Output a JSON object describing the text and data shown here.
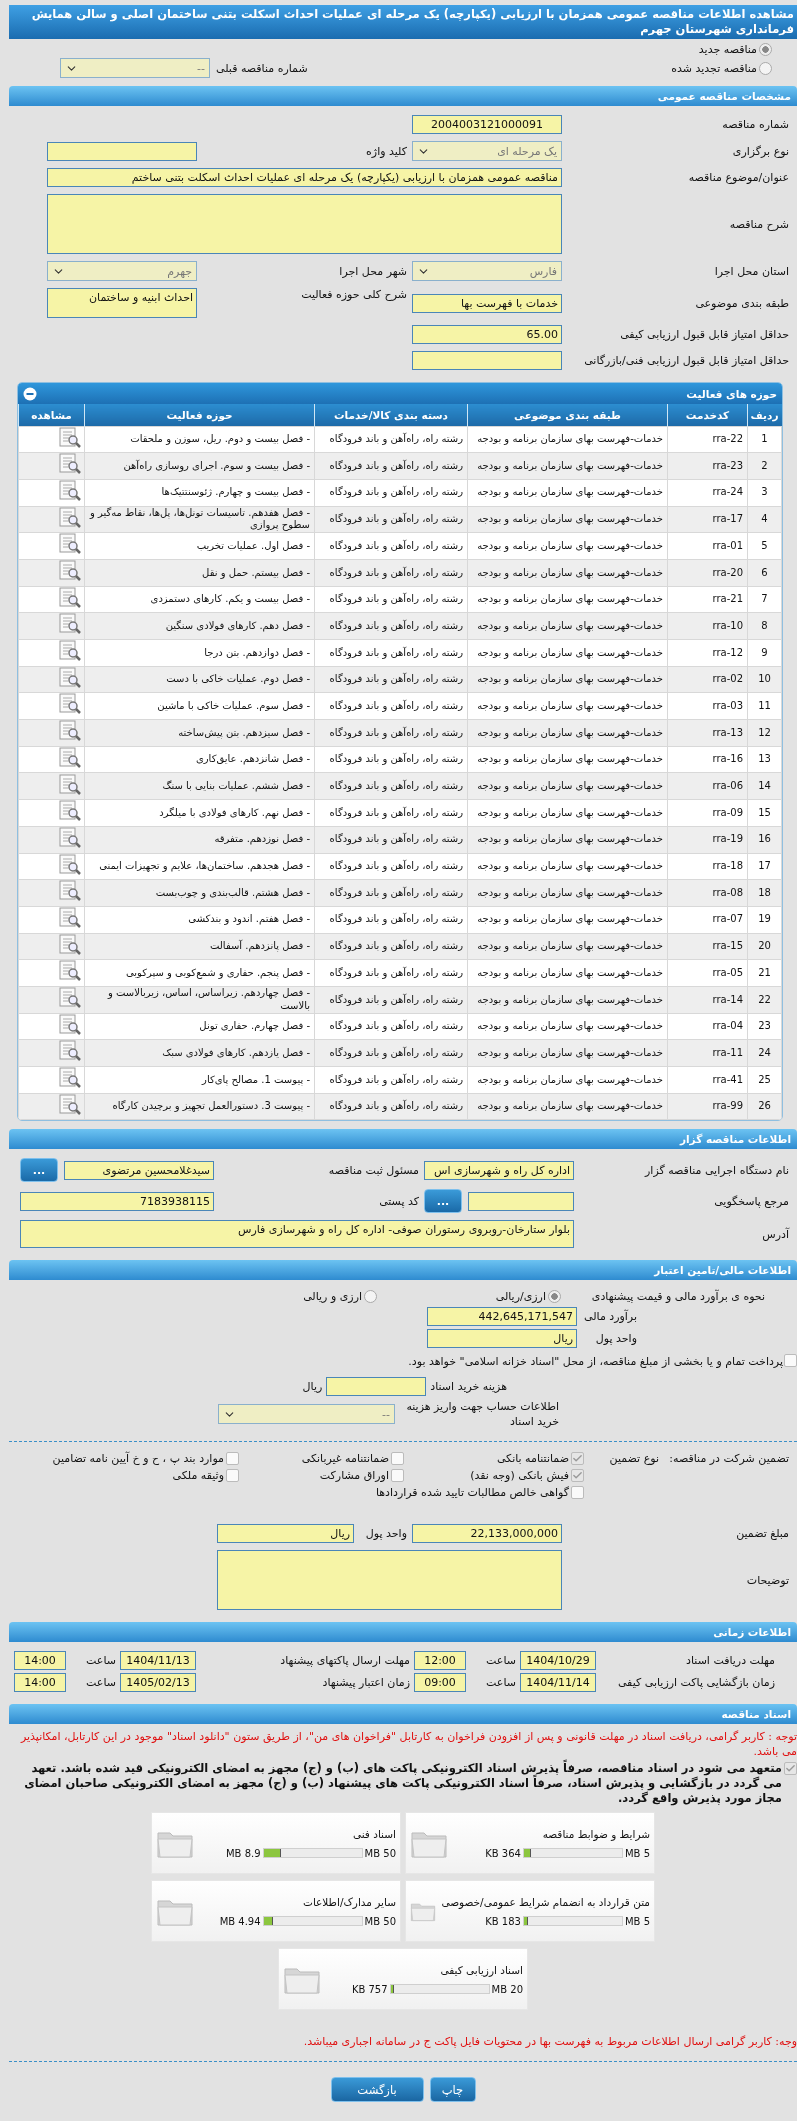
{
  "title": "مشاهده اطلاعات مناقصه عمومی همزمان با ارزیابی (یکپارچه) یک مرحله ای عملیات احداث اسکلت بتنی ساختمان اصلی و سالن همایش فرمانداری شهرستان جهرم",
  "tender_mode": {
    "options": [
      {
        "label": "مناقصه جدید",
        "selected": true
      },
      {
        "label": "مناقصه تجدید شده",
        "selected": false
      }
    ],
    "previous": {
      "label": "شماره مناقصه قبلی",
      "value": "--"
    }
  },
  "general": {
    "header": "مشخصات مناقصه عمومی",
    "rows": [
      [
        {
          "label": "شماره مناقصه",
          "value": "2004003121000091",
          "kind": "code"
        }
      ],
      [
        {
          "label": "نوع برگزاری",
          "value": "یک مرحله ای",
          "kind": "select"
        },
        {
          "label": "کلید واژه",
          "kind": "input"
        }
      ],
      [
        {
          "label": "عنوان/موضوع مناقصه",
          "value": "مناقصه عمومی همزمان با ارزیابی (یکپارچه) یک مرحله ای عملیات احداث اسکلت بتنی ساختم",
          "kind": "wide_input"
        }
      ],
      [
        {
          "label": "شرح مناقصه",
          "kind": "wide_area"
        }
      ],
      [
        {
          "label": "استان محل اجرا",
          "value": "فارس",
          "kind": "select"
        },
        {
          "label": "شهر محل اجرا",
          "value": "جهرم",
          "kind": "select"
        }
      ],
      [
        {
          "label": "طبقه بندی موضوعی",
          "value": "خدمات با فهرست بها",
          "kind": "input"
        },
        {
          "label": "شرح کلی حوزه فعالیت",
          "value": "احداث ابنیه و ساختمان",
          "kind": "memo"
        }
      ],
      [
        {
          "label": "حداقل امتیاز قابل قبول ارزیابی کیفی",
          "value": "65.00",
          "kind": "input"
        }
      ],
      [
        {
          "label": "حداقل امتیاز قابل قبول ارزیابی فنی/بازرگانی",
          "kind": "input"
        }
      ]
    ]
  },
  "activities": {
    "header": "حوزه های فعالیت",
    "columns": [
      "ردیف",
      "کدخدمت",
      "طبقه بندی موضوعی",
      "دسته بندی کالا/خدمات",
      "حوزه فعالیت",
      "مشاهده"
    ],
    "rows": [
      {
        "index": "1",
        "code": "rra-22",
        "category": "خدمات-فهرست بهای سازمان برنامه و بودجه",
        "group": "رشته راه، راه‌آهن و باند فرودگاه",
        "activity": "- فصل بیست و دوم. ریل، سوزن و ملحقات"
      },
      {
        "index": "2",
        "code": "rra-23",
        "category": "خدمات-فهرست بهای سازمان برنامه و بودجه",
        "group": "رشته راه، راه‌آهن و باند فرودگاه",
        "activity": "- فصل بیست و سوم. اجرای روسازی راه‌آهن"
      },
      {
        "index": "3",
        "code": "rra-24",
        "category": "خدمات-فهرست بهای سازمان برنامه و بودجه",
        "group": "رشته راه، راه‌آهن و باند فرودگاه",
        "activity": "- فصل بیست و چهارم. ژئوسنتتیک‌ها"
      },
      {
        "index": "4",
        "code": "rra-17",
        "category": "خدمات-فهرست بهای سازمان برنامه و بودجه",
        "group": "رشته راه، راه‌آهن و باند فرودگاه",
        "activity": "- فصل هفدهم. تاسیسات تونل‌ها، پل‌ها، نقاط مه‌گیر و سطوح پروازی"
      },
      {
        "index": "5",
        "code": "rra-01",
        "category": "خدمات-فهرست بهای سازمان برنامه و بودجه",
        "group": "رشته راه، راه‌آهن و باند فرودگاه",
        "activity": "- فصل اول. عملیات تخریب"
      },
      {
        "index": "6",
        "code": "rra-20",
        "category": "خدمات-فهرست بهای سازمان برنامه و بودجه",
        "group": "رشته راه، راه‌آهن و باند فرودگاه",
        "activity": "- فصل بیستم. حمل و نقل"
      },
      {
        "index": "7",
        "code": "rra-21",
        "category": "خدمات-فهرست بهای سازمان برنامه و بودجه",
        "group": "رشته راه، راه‌آهن و باند فرودگاه",
        "activity": "- فصل بیست و یکم. کارهای دستمزدی"
      },
      {
        "index": "8",
        "code": "rra-10",
        "category": "خدمات-فهرست بهای سازمان برنامه و بودجه",
        "group": "رشته راه، راه‌آهن و باند فرودگاه",
        "activity": "- فصل دهم. کارهای فولادی سنگین"
      },
      {
        "index": "9",
        "code": "rra-12",
        "category": "خدمات-فهرست بهای سازمان برنامه و بودجه",
        "group": "رشته راه، راه‌آهن و باند فرودگاه",
        "activity": "- فصل دوازدهم. بتن درجا"
      },
      {
        "index": "10",
        "code": "rra-02",
        "category": "خدمات-فهرست بهای سازمان برنامه و بودجه",
        "group": "رشته راه، راه‌آهن و باند فرودگاه",
        "activity": "- فصل دوم. عملیات خاکی با دست"
      },
      {
        "index": "11",
        "code": "rra-03",
        "category": "خدمات-فهرست بهای سازمان برنامه و بودجه",
        "group": "رشته راه، راه‌آهن و باند فرودگاه",
        "activity": "- فصل سوم. عملیات خاکی با ماشین"
      },
      {
        "index": "12",
        "code": "rra-13",
        "category": "خدمات-فهرست بهای سازمان برنامه و بودجه",
        "group": "رشته راه، راه‌آهن و باند فرودگاه",
        "activity": "- فصل سیزدهم. بتن پیش‌ساخته"
      },
      {
        "index": "13",
        "code": "rra-16",
        "category": "خدمات-فهرست بهای سازمان برنامه و بودجه",
        "group": "رشته راه، راه‌آهن و باند فرودگاه",
        "activity": "- فصل شانزدهم. عایق‌کاری"
      },
      {
        "index": "14",
        "code": "rra-06",
        "category": "خدمات-فهرست بهای سازمان برنامه و بودجه",
        "group": "رشته راه، راه‌آهن و باند فرودگاه",
        "activity": "- فصل ششم. عملیات بنایی با سنگ"
      },
      {
        "index": "15",
        "code": "rra-09",
        "category": "خدمات-فهرست بهای سازمان برنامه و بودجه",
        "group": "رشته راه، راه‌آهن و باند فرودگاه",
        "activity": "- فصل نهم. کارهای فولادی با میلگرد"
      },
      {
        "index": "16",
        "code": "rra-19",
        "category": "خدمات-فهرست بهای سازمان برنامه و بودجه",
        "group": "رشته راه، راه‌آهن و باند فرودگاه",
        "activity": "- فصل نوزدهم. متفرقه"
      },
      {
        "index": "17",
        "code": "rra-18",
        "category": "خدمات-فهرست بهای سازمان برنامه و بودجه",
        "group": "رشته راه، راه‌آهن و باند فرودگاه",
        "activity": "- فصل هجدهم. ساختمان‌ها، علایم و تجهیزات ایمنی"
      },
      {
        "index": "18",
        "code": "rra-08",
        "category": "خدمات-فهرست بهای سازمان برنامه و بودجه",
        "group": "رشته راه، راه‌آهن و باند فرودگاه",
        "activity": "- فصل هشتم. قالب‌بندی و چوب‌بست"
      },
      {
        "index": "19",
        "code": "rra-07",
        "category": "خدمات-فهرست بهای سازمان برنامه و بودجه",
        "group": "رشته راه، راه‌آهن و باند فرودگاه",
        "activity": "- فصل هفتم. اندود و بندکشی"
      },
      {
        "index": "20",
        "code": "rra-15",
        "category": "خدمات-فهرست بهای سازمان برنامه و بودجه",
        "group": "رشته راه، راه‌آهن و باند فرودگاه",
        "activity": "- فصل پانزدهم. آسفالت"
      },
      {
        "index": "21",
        "code": "rra-05",
        "category": "خدمات-فهرست بهای سازمان برنامه و بودجه",
        "group": "رشته راه، راه‌آهن و باند فرودگاه",
        "activity": "- فصل پنجم. حفاری و شمع‌کوبی و سپرکوبی"
      },
      {
        "index": "22",
        "code": "rra-14",
        "category": "خدمات-فهرست بهای سازمان برنامه و بودجه",
        "group": "رشته راه، راه‌آهن و باند فرودگاه",
        "activity": "- فصل چهاردهم. زیراساس، اساس، زیربالاست و بالاست"
      },
      {
        "index": "23",
        "code": "rra-04",
        "category": "خدمات-فهرست بهای سازمان برنامه و بودجه",
        "group": "رشته راه، راه‌آهن و باند فرودگاه",
        "activity": "- فصل چهارم. حفاری تونل"
      },
      {
        "index": "24",
        "code": "rra-11",
        "category": "خدمات-فهرست بهای سازمان برنامه و بودجه",
        "group": "رشته راه، راه‌آهن و باند فرودگاه",
        "activity": "- فصل یازدهم. کارهای فولادی سبک"
      },
      {
        "index": "25",
        "code": "rra-41",
        "category": "خدمات-فهرست بهای سازمان برنامه و بودجه",
        "group": "رشته راه، راه‌آهن و باند فرودگاه",
        "activity": "- پیوست 1. مصالح پای‌کار"
      },
      {
        "index": "26",
        "code": "rra-99",
        "category": "خدمات-فهرست بهای سازمان برنامه و بودجه",
        "group": "رشته راه، راه‌آهن و باند فرودگاه",
        "activity": "- پیوست 3. دستورالعمل تجهیز و برچیدن کارگاه"
      }
    ]
  },
  "organizer": {
    "header": "اطلاعات مناقصه گزار",
    "rows": [
      [
        {
          "label": "نام دستگاه اجرایی مناقصه گزار",
          "value": "اداره کل راه و شهرسازی اس",
          "kind": "input"
        },
        {
          "label": "مسئول ثبت مناقصه",
          "value": "سیدغلامحسین مرتضوی",
          "kind": "picker",
          "button": "..."
        }
      ],
      [
        {
          "label": "مرجع پاسخگویی",
          "kind": "picker",
          "button": "..."
        },
        {
          "label": "کد پستی",
          "value": "7183938115",
          "kind": "input"
        }
      ],
      [
        {
          "label": "آدرس",
          "value": "بلوار ستارخان-روبروی رستوران صوفی- اداره کل راه و شهرسازی فارس",
          "kind": "wide_memo"
        }
      ]
    ]
  },
  "finance": {
    "header": "اطلاعات مالی/تامین اعتبار",
    "method": {
      "label": "نحوه ی برآورد مالی و قیمت پیشنهادی",
      "options": [
        {
          "label": "ارزی/ریالی",
          "selected": true
        },
        {
          "label": "ارزی و ریالی",
          "selected": false
        }
      ]
    },
    "estimate": {
      "label": "برآورد مالی",
      "value": "442,645,171,547"
    },
    "currency": {
      "label": "واحد پول",
      "value": "ریال"
    },
    "treasury": {
      "text": "پرداخت تمام و یا بخشی از مبلغ مناقصه، از محل \"اسناد خزانه اسلامی\" خواهد بود.",
      "checked": false
    },
    "doc_fee": {
      "label": "هزینه خرید اسناد",
      "unit": "ریال"
    },
    "account": {
      "label": "اطلاعات حساب جهت واریز هزینه خرید اسناد",
      "value": "--"
    }
  },
  "guarantee": {
    "title": "تضمین شرکت در مناقصه:",
    "type_label": "نوع تضمین",
    "items": [
      {
        "label": "ضمانتنامه بانکی",
        "checked": true
      },
      {
        "label": "ضمانتنامه غیربانکی",
        "checked": false
      },
      {
        "label": "موارد بند پ ، ح و خ آیین نامه تضامین",
        "checked": false
      },
      {
        "label": "فیش بانکی (وجه نقد)",
        "checked": true
      },
      {
        "label": "اوراق مشارکت",
        "checked": false
      },
      {
        "label": "وثیقه ملکی",
        "checked": false
      },
      {
        "label": "گواهی خالص مطالبات تایید شده قراردادها",
        "checked": false
      }
    ],
    "rows": [
      [
        {
          "label": "مبلغ تضمین",
          "value": "22,133,000,000",
          "kind": "input"
        },
        {
          "label": "واحد پول",
          "value": "ریال",
          "kind": "input"
        }
      ],
      [
        {
          "label": "توضیحات",
          "kind": "wide_area"
        }
      ]
    ]
  },
  "schedule": {
    "header": "اطلاعات زمانی",
    "items": [
      {
        "label": "مهلت دریافت اسناد",
        "date": "1404/10/29",
        "time_label": "ساعت",
        "time": "12:00"
      },
      {
        "label": "مهلت ارسال پاکتهای پیشنهاد",
        "date": "1404/11/13",
        "time_label": "ساعت",
        "time": "14:00"
      },
      {
        "label": "زمان بازگشایی پاکت ارزیابی کیفی",
        "date": "1404/11/14",
        "time_label": "ساعت",
        "time": "09:00"
      },
      {
        "label": "زمان اعتبار پیشنهاد",
        "date": "1405/02/13",
        "time_label": "ساعت",
        "time": "14:00"
      }
    ]
  },
  "documents": {
    "header": "اسناد مناقصه",
    "notice": "توجه : کاربر گرامی، دریافت اسناد در مهلت قانونی و پس از افزودن فراخوان به کارتابل \"فراخوان های من\"، از طریق ستون \"دانلود اسناد\" موجود در این کارتابل، امکانپذیر می باشد.",
    "commitment": {
      "text": "متعهد می شود در اسناد مناقصه، صرفاً پذیرش اسناد الکترونیکی پاکت های (ب) و (ج) مجهز به امضای الکترونیکی قید شده باشد. تعهد می گردد در بازگشایی و پذیرش اسناد، صرفاً اسناد الکترونیکی پاکت های پیشنهاد (ب) و (ج) مجهز به امضای الکترونیکی صاحبان امضای مجاز مورد پذیرش واقع گردد.",
      "checked": true
    },
    "files": [
      {
        "title": "شرایط و ضوابط مناقصه",
        "size": "364 KB",
        "max": "5 MB",
        "level": 0.07
      },
      {
        "title": "اسناد فنی",
        "size": "8.9 MB",
        "max": "50 MB",
        "level": 0.18
      },
      {
        "title": "متن قرارداد به انضمام شرایط عمومی/خصوصی",
        "size": "183 KB",
        "max": "5 MB",
        "level": 0.04
      },
      {
        "title": "سایر مدارک/اطلاعات",
        "size": "4.94 MB",
        "max": "50 MB",
        "level": 0.1
      },
      {
        "title": "اسناد ارزیابی کیفی",
        "size": "757 KB",
        "max": "20 MB",
        "level": 0.04
      }
    ],
    "footer_note": "وجه: کاربر گرامی ارسال اطلاعات مربوط به فهرست بها در محتویات فایل پاکت ج در سامانه اجباری میباشد."
  },
  "buttons": [
    {
      "label": "چاپ"
    },
    {
      "label": "بازگشت"
    }
  ]
}
